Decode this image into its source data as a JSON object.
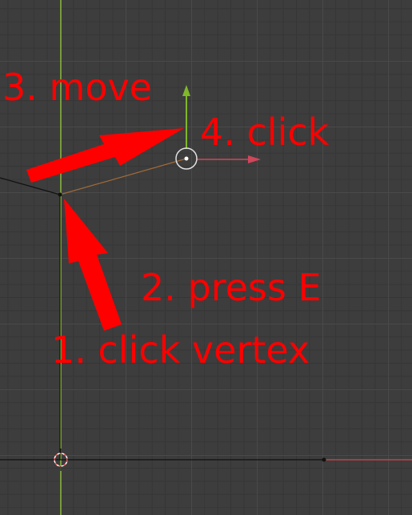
{
  "annotations": {
    "step1": "1. click vertex",
    "step2": "2. press E",
    "step3": "3. move",
    "step4": "4. click"
  },
  "colors": {
    "background": "#3d3d3d",
    "annotation": "#ff0000",
    "y_axis": "#8ab83a",
    "x_axis": "#c0424a",
    "gizmo_y": "#7fb82a",
    "gizmo_x": "#d0465a",
    "edge": "#111111",
    "extruded_edge": "#a06a3a"
  }
}
